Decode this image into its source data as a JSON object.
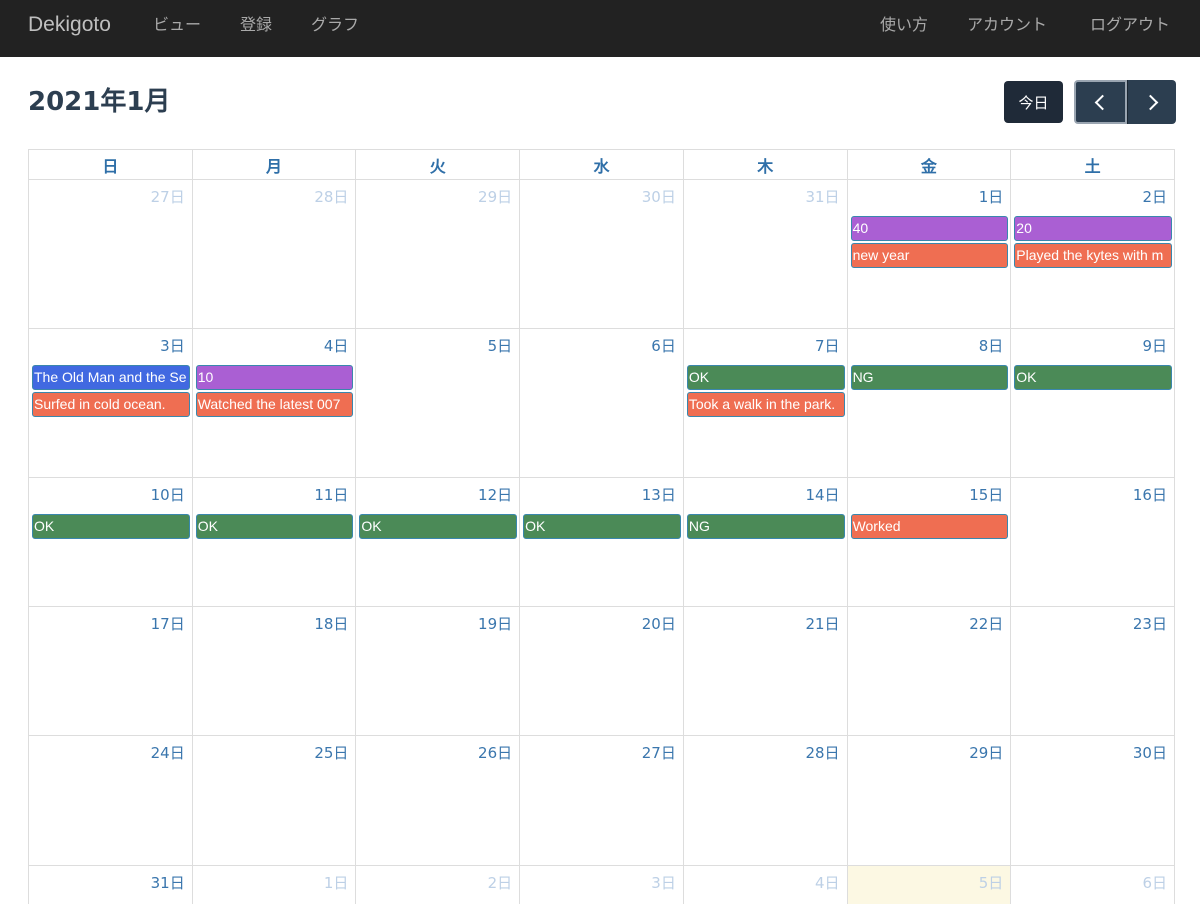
{
  "navbar": {
    "brand": "Dekigoto",
    "left_items": [
      "ビュー",
      "登録",
      "グラフ"
    ],
    "right_items": [
      "使い方",
      "アカウント",
      "ログアウト"
    ]
  },
  "calendar": {
    "title": "2021年1月",
    "today_button": "今日",
    "prev_icon": "chevron-left-icon",
    "next_icon": "chevron-right-icon",
    "weekdays": [
      "日",
      "月",
      "火",
      "水",
      "木",
      "金",
      "土"
    ],
    "colors": {
      "purple": "#aa5fd3",
      "orange": "#ef6e52",
      "blue": "#4169e1",
      "green": "#4b8a57",
      "today_bg": "#fcf8e3"
    },
    "weeks": [
      [
        {
          "label": "27日",
          "other": true,
          "events": []
        },
        {
          "label": "28日",
          "other": true,
          "events": []
        },
        {
          "label": "29日",
          "other": true,
          "events": []
        },
        {
          "label": "30日",
          "other": true,
          "events": []
        },
        {
          "label": "31日",
          "other": true,
          "events": []
        },
        {
          "label": "1日",
          "events": [
            {
              "title": "40",
              "color": "purple"
            },
            {
              "title": "new year",
              "color": "orange"
            }
          ]
        },
        {
          "label": "2日",
          "events": [
            {
              "title": "20",
              "color": "purple"
            },
            {
              "title": "Played the kytes with m",
              "color": "orange"
            }
          ]
        }
      ],
      [
        {
          "label": "3日",
          "events": [
            {
              "title": "The Old Man and the Se",
              "color": "blue"
            },
            {
              "title": "Surfed in cold ocean.",
              "color": "orange"
            }
          ]
        },
        {
          "label": "4日",
          "events": [
            {
              "title": "10",
              "color": "purple"
            },
            {
              "title": "Watched the latest 007",
              "color": "orange"
            }
          ]
        },
        {
          "label": "5日",
          "events": []
        },
        {
          "label": "6日",
          "events": []
        },
        {
          "label": "7日",
          "events": [
            {
              "title": "OK",
              "color": "green"
            },
            {
              "title": "Took a walk in the park.",
              "color": "orange"
            }
          ]
        },
        {
          "label": "8日",
          "events": [
            {
              "title": "NG",
              "color": "green"
            }
          ]
        },
        {
          "label": "9日",
          "events": [
            {
              "title": "OK",
              "color": "green"
            }
          ]
        }
      ],
      [
        {
          "label": "10日",
          "events": [
            {
              "title": "OK",
              "color": "green"
            }
          ]
        },
        {
          "label": "11日",
          "events": [
            {
              "title": "OK",
              "color": "green"
            }
          ]
        },
        {
          "label": "12日",
          "events": [
            {
              "title": "OK",
              "color": "green"
            }
          ]
        },
        {
          "label": "13日",
          "events": [
            {
              "title": "OK",
              "color": "green"
            }
          ]
        },
        {
          "label": "14日",
          "events": [
            {
              "title": "NG",
              "color": "green"
            }
          ]
        },
        {
          "label": "15日",
          "events": [
            {
              "title": "Worked",
              "color": "orange"
            }
          ]
        },
        {
          "label": "16日",
          "events": []
        }
      ],
      [
        {
          "label": "17日",
          "events": []
        },
        {
          "label": "18日",
          "events": []
        },
        {
          "label": "19日",
          "events": []
        },
        {
          "label": "20日",
          "events": []
        },
        {
          "label": "21日",
          "events": []
        },
        {
          "label": "22日",
          "events": []
        },
        {
          "label": "23日",
          "events": []
        }
      ],
      [
        {
          "label": "24日",
          "events": []
        },
        {
          "label": "25日",
          "events": []
        },
        {
          "label": "26日",
          "events": []
        },
        {
          "label": "27日",
          "events": []
        },
        {
          "label": "28日",
          "events": []
        },
        {
          "label": "29日",
          "events": []
        },
        {
          "label": "30日",
          "events": []
        }
      ],
      [
        {
          "label": "31日",
          "events": []
        },
        {
          "label": "1日",
          "other": true,
          "events": []
        },
        {
          "label": "2日",
          "other": true,
          "events": []
        },
        {
          "label": "3日",
          "other": true,
          "events": []
        },
        {
          "label": "4日",
          "other": true,
          "events": []
        },
        {
          "label": "5日",
          "other": true,
          "today": true,
          "events": []
        },
        {
          "label": "6日",
          "other": true,
          "events": []
        }
      ]
    ]
  }
}
